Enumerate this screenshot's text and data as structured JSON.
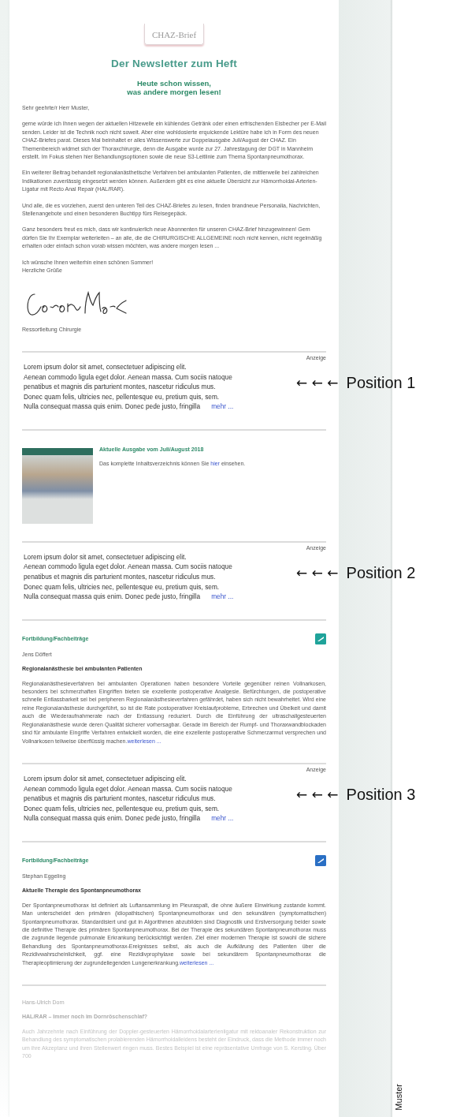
{
  "logo": {
    "text": "CHAZ-Brief"
  },
  "headline": "Der Newsletter zum Heft",
  "tagline": [
    "Heute schon wissen,",
    "was andere morgen lesen!"
  ],
  "letter": {
    "salutation": "Sehr geehrte/r Herr Muster,",
    "paragraphs": [
      "gerne würde ich Ihnen wegen der aktuellen Hitzewelle ein kühlendes Getränk oder einen erfrischenden Eisbecher per E-Mail senden. Leider ist die Technik noch nicht soweit. Aber eine wohldosierte erquickende Lektüre habe ich in Form des neuen CHAZ-Briefes parat. Dieses Mal beinhaltet er alles Wissenswerte zur Doppelausgabe Juli/August der CHAZ. Ein Themenbereich widmet sich der Thoraxchirurgie, denn die Ausgabe wurde zur 27. Jahrestagung der DGT in Mannheim erstellt. Im Fokus stehen hier Behandlungsoptionen sowie die neue S3-Leitlinie zum Thema Spontanpneumothorax.",
      "Ein weiterer Beitrag behandelt regionalanästhetische Verfahren bei ambulanten Patienten, die mittlerweile bei zahlreichen Indikationen zuverlässig eingesetzt werden können. Außerdem gibt es eine aktuelle Übersicht zur Hämorrhoidal-Arterien-Ligatur mit Recto Anal Repair (HAL/RAR).",
      "Und alle, die es vorziehen, zuerst den unteren Teil des CHAZ-Briefes zu lesen, finden brandneue Personalia, Nachrichten, Stellenangebote und einen besonderen Buchtipp fürs Reisegepäck.",
      "Ganz besonders freut es mich, dass wir kontinuierlich neue Abonnenten für unseren CHAZ-Brief hinzugewinnen! Gern dürfen Sie Ihr Exemplar weiterleiten – an alle, die die CHIRURGISCHE ALLGEMEINE noch nicht kennen, nicht regelmäßig erhalten oder einfach schon vorab wissen möchten, was andere morgen lesen ..."
    ],
    "closing": [
      "Ich wünsche Ihnen weiterhin einen schönen Sommer!",
      "Herzliche Grüße"
    ],
    "role": "Ressortleitung Chirurgie"
  },
  "blocks": [
    {
      "kind": "ad",
      "label": "Anzeige",
      "lines": [
        "Lorem ipsum dolor sit amet, consectetuer adipiscing elit.",
        "Aenean commodo ligula eget dolor. Aenean massa. Cum sociis natoque",
        "penatibus et magnis dis parturient montes, nascetur ridiculus mus.",
        "Donec quam felis, ultricies nec, pellentesque eu, pretium quis, sem.",
        "Nulla consequat massa quis enim. Donec pede justo, fringilla"
      ],
      "link": "mehr ...",
      "annotation": {
        "arrows": "← ← ←",
        "text": "Position 1"
      }
    },
    {
      "kind": "issue",
      "title": "Aktuelle Ausgabe vom Juli/August 2018",
      "text_before": "Das komplette Inhaltsverzeichnis können Sie",
      "link": "hier",
      "text_after": "einsehen."
    },
    {
      "kind": "ad",
      "label": "Anzeige",
      "lines": [
        "Lorem ipsum dolor sit amet, consectetuer adipiscing elit.",
        "Aenean commodo ligula eget dolor. Aenean massa. Cum sociis natoque",
        "penatibus et magnis dis parturient montes, nascetur ridiculus mus.",
        "Donec quam felis, ultricies nec, pellentesque eu, pretium quis, sem.",
        "Nulla consequat massa quis enim. Donec pede justo, fringilla"
      ],
      "link": "mehr ...",
      "annotation": {
        "arrows": "← ← ←",
        "text": "Position 2"
      }
    },
    {
      "kind": "article",
      "faded": false,
      "category": "Fortbildung/Fachbeiträge",
      "color": "#1fa39a",
      "author": "Jens Döffert",
      "title": "Regionalanästhesie bei ambulanten Patienten",
      "body": "Regionalanästhesieverfahren bei ambulanten Operationen haben besondere Vorteile gegenüber reinen Vollnarkosen, besonders bei schmerzhaften Eingriffen bieten sie exzellente postoperative Analgesie. Befürchtungen, die postoperative schnelle Entlassbarkeit sei bei peripheren Regionalanästhesieverfahren gefährdet, haben sich nicht bewahrheitet. Wird eine reine Regionalanästhesie durchgeführt, so ist die Rate postoperativer Kreislaufprobleme, Erbrechen und Übelkeit und damit auch die Wiederaufnahmerate nach der Entlassung reduziert. Durch die Einführung der ultraschallgesteuerten Regionalanästhesie wurde deren Qualität sicherer vorhersagbar. Gerade im Bereich der Rumpf- und Thoraxwandblockaden sind für ambulante Eingriffe Verfahren entwickelt worden, die eine exzellente postoperative Schmerzarmut versprechen und Vollnarkosen teilweise überflüssig machen.",
      "link": "weiterlesen ..."
    },
    {
      "kind": "ad",
      "label": "Anzeige",
      "lines": [
        "Lorem ipsum dolor sit amet, consectetuer adipiscing elit.",
        "Aenean commodo ligula eget dolor. Aenean massa. Cum sociis natoque",
        "penatibus et magnis dis parturient montes, nascetur ridiculus mus.",
        "Donec quam felis, ultricies nec, pellentesque eu, pretium quis, sem.",
        "Nulla consequat massa quis enim. Donec pede justo, fringilla"
      ],
      "link": "mehr ...",
      "annotation": {
        "arrows": "← ← ←",
        "text": "Position 3"
      }
    },
    {
      "kind": "article",
      "faded": false,
      "category": "Fortbildung/Fachbeiträge",
      "color": "#2a6fc4",
      "author": "Stephan Eggeling",
      "title": "Aktuelle Therapie des Spontanpneumothorax",
      "body": "Der Spontanpneumothorax ist definiert als Luftansammlung im Pleuraspalt, die ohne äußere Einwirkung zustande kommt. Man unterscheidet den primären (idiopathischen) Spontanpneumothorax und den sekundären (symptomatischen) Spontanpneumothorax. Standardisiert und gut in Algorithmen abzubilden sind Diagnostik und Erstversorgung beider sowie die definitive Therapie des primären Spontanpneumothorax. Bei der Therapie des sekundären Spontanpneumothorax muss die zugrunde liegende pulmonale Erkrankung berücksichtigt werden. Ziel einer modernen Therapie ist sowohl die sichere Behandlung des Spontanpneumothorax-Ereignisses selbst, als auch die Aufklärung des Patienten über die Rezidivwahrscheinlichkeit, ggf. eine Rezidivprophylaxe sowie bei sekundärem Spontanpneumothorax die Therapieoptimierung der zugrundeliegenden Lungenerkrankung.",
      "link": "weiterlesen ..."
    },
    {
      "kind": "article",
      "faded": true,
      "author": "Hans-Ulrich Dorn",
      "title": "HAL/RAR – Immer noch im Dornröschenschlaf?",
      "body": "Auch Jahrzehnte nach Einführung der Doppler-gesteuerten Hämorrhoidalarterienligatur mit rektoanaler Rekonstruktion zur Behandlung des symptomatischen prolabierenden Hämorrhoidalleidens besteht der Eindruck, dass die Methode immer noch um ihre Akzeptanz und ihren Stellenwert ringen muss. Bestes Beispiel ist eine repräsentative Umfrage von S. Kersting. Über 700"
    }
  ],
  "side_mark": "Muster"
}
